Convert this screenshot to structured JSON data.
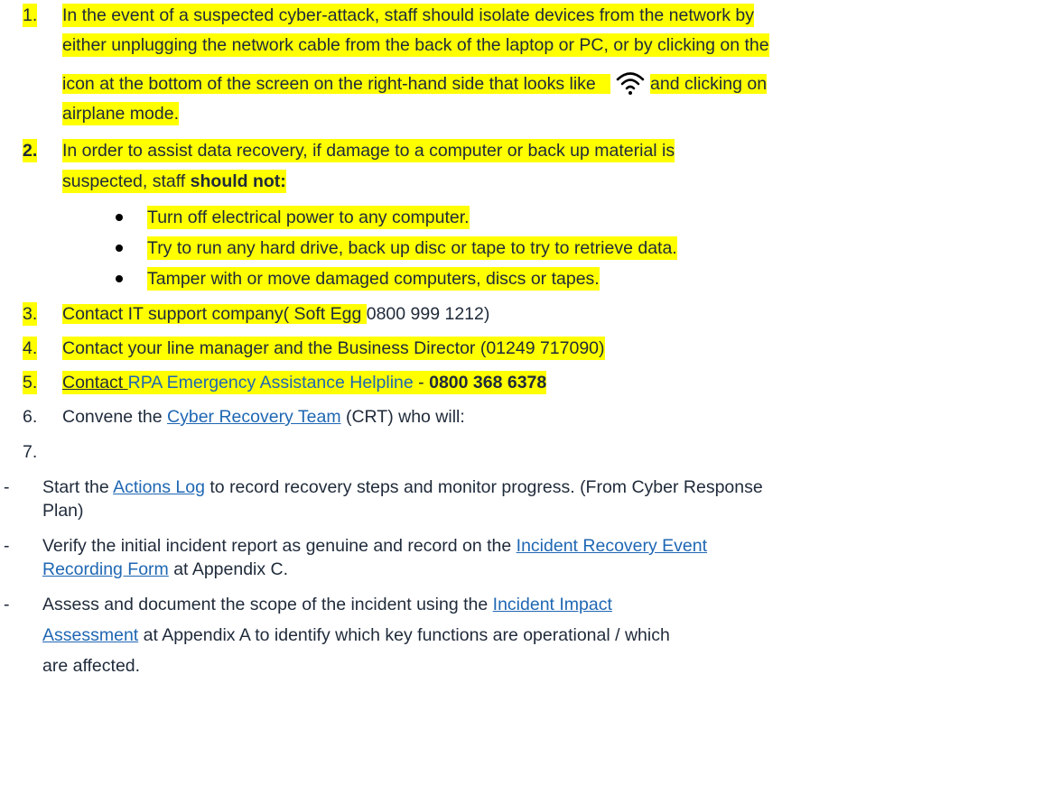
{
  "item1": {
    "num": "1.",
    "line1": "In the event of a suspected cyber-attack, staff should isolate devices from the network by",
    "line2": "either unplugging the network cable from the back of the laptop or PC, or by clicking on the",
    "line3_pre": "icon at the bottom of the screen on the right-hand side that looks like",
    "line3_post": "and clicking on",
    "line4": "airplane mode.",
    "icon": "wifi-icon"
  },
  "item2": {
    "num": "2.",
    "line1": "In order to assist data recovery, if damage to a computer or back up material is",
    "line2_pre": "suspected, staff ",
    "line2_bold": "should not:",
    "bullets": [
      "Turn off electrical power to any computer.",
      "Try to run any hard drive, back up disc or tape to try to retrieve data.",
      "Tamper with or move damaged computers, discs or tapes."
    ]
  },
  "item3": {
    "num": "3.",
    "pre": "Contact  IT support company( Soft Egg ",
    "post": "0800 999 1212)"
  },
  "item4": {
    "num": "4.",
    "text": "Contact your line manager and the Business Director (01249 717090)"
  },
  "item5": {
    "num": "5.",
    "pre": "Contact ",
    "link": "RPA Emergency Assistance Helpline",
    "sep": " - ",
    "phone": "0800 368 6378"
  },
  "item6": {
    "num": "6.",
    "pre": "Convene the ",
    "link": "Cyber Recovery Team",
    "post": " (CRT) who will:"
  },
  "item7": {
    "num": "7."
  },
  "dash_items": [
    {
      "pre": "Start the ",
      "link": "Actions Log",
      "post": " to record recovery steps and monitor progress. (From Cyber Response",
      "cont": "Plan)"
    },
    {
      "pre": "Verify the initial incident report as genuine and record on the ",
      "link": "Incident Recovery Event",
      "link2": "Recording Form",
      "post": " at Appendix C."
    },
    {
      "pre": "Assess and document the scope of the incident using the ",
      "link": "Incident Impact",
      "link2": "Assessment",
      "post": " at Appendix A to identify which key functions are operational / which",
      "cont": "are affected."
    }
  ]
}
